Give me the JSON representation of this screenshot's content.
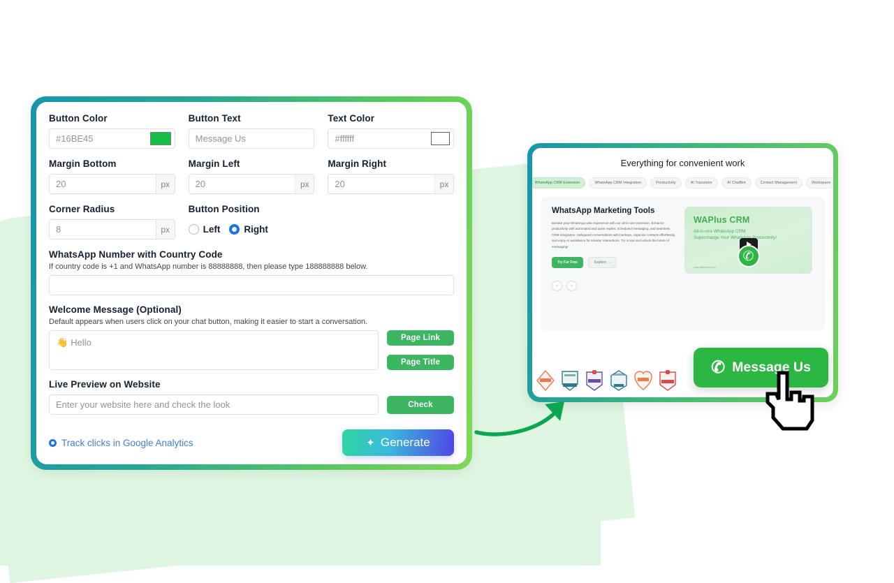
{
  "config": {
    "button_color": {
      "label": "Button Color",
      "value": "#16BE45",
      "swatch": "#16be45",
      "swatch_icon": "color-swatch-green"
    },
    "button_text": {
      "label": "Button Text",
      "placeholder": "Message Us"
    },
    "text_color": {
      "label": "Text Color",
      "value": "#ffffff",
      "swatch": "#ffffff",
      "swatch_icon": "color-swatch-white"
    },
    "margin_bottom": {
      "label": "Margin Bottom",
      "value": "20",
      "unit": "px"
    },
    "margin_left": {
      "label": "Margin Left",
      "value": "20",
      "unit": "px"
    },
    "margin_right": {
      "label": "Margin Right",
      "value": "20",
      "unit": "px"
    },
    "corner_radius": {
      "label": "Corner Radius",
      "value": "8",
      "unit": "px"
    },
    "button_position": {
      "label": "Button Position",
      "options": [
        "Left",
        "Right"
      ],
      "selected": "Right",
      "accent": "#1a73e8"
    },
    "whatsapp_number": {
      "label": "WhatsApp Number with Country Code",
      "hint": "If country code is +1 and WhatsApp number is 88888888, then please type 188888888 below.",
      "value": ""
    },
    "welcome_message": {
      "label": "Welcome Message (Optional)",
      "hint": "Default appears when users click on your chat button, making it easier to start a conversation.",
      "value": "Hello",
      "emoji": "👋",
      "page_link_label": "Page Link",
      "page_title_label": "Page Title"
    },
    "live_preview": {
      "label": "Live Preview on Website",
      "placeholder": "Enter your website here and check the look",
      "check_label": "Check"
    },
    "track_clicks": {
      "label": "Track clicks in Google Analytics",
      "selected": true,
      "color": "#3f7fd6"
    },
    "generate": {
      "label": "Generate",
      "icon": "sparkles-icon",
      "gradient_from": "#2fd6a0",
      "gradient_to": "#4f46e5"
    }
  },
  "preview": {
    "site_title": "Everything for convenient work",
    "tabs": [
      {
        "label": "WhatsApp CRM Extension",
        "active": true
      },
      {
        "label": "WhatsApp CRM Integration",
        "active": false
      },
      {
        "label": "Productivity",
        "active": false
      },
      {
        "label": "AI Translator",
        "active": false
      },
      {
        "label": "AI ChatBot",
        "active": false
      },
      {
        "label": "Contact Management",
        "active": false
      },
      {
        "label": "Workspace",
        "active": false
      }
    ],
    "hero": {
      "heading": "WhatsApp Marketing Tools",
      "paragraph": "Elevate your WhatsApp web experience with our all-in-one extension. Enhance productivity with automated and quick replies, scheduled messaging, and seamless CRM integration. Safeguard conversations with backups, organize contacts effortlessly, and enjoy AI assistance for smarter interactions. Try it now and unlock the future of messaging!",
      "primary_button": "Try For Free",
      "secondary_button": "Explore  →"
    },
    "promo": {
      "title": "WAPlus CRM",
      "subtitle_1": "All-in-one WhatsApp CRM",
      "subtitle_2": "Supercharge Your WhatsApp Productivity!",
      "footer": "www.wapluscrm.com",
      "play_icon": "youtube-play-icon",
      "logo_icon": "whatsapp-logo-icon"
    },
    "carousel": {
      "prev": "‹",
      "next": "›"
    },
    "badges": [
      {
        "name": "high-performer-badge",
        "color": "#f0784a"
      },
      {
        "name": "top-performer-badge",
        "color": "#2e7d8f"
      },
      {
        "name": "best-est-roi-badge",
        "color": "#6b4fa0"
      },
      {
        "name": "users-love-us-badge",
        "color": "#2e7d8f"
      },
      {
        "name": "customers-love-us-badge",
        "color": "#f0784a"
      },
      {
        "name": "high-performer-fall-badge",
        "color": "#d94c4c"
      }
    ]
  },
  "floating_button": {
    "label": "Message Us",
    "icon": "whatsapp-icon",
    "background": "#2bb741",
    "text_color": "#ffffff"
  },
  "decor": {
    "arrow_icon": "curved-arrow-icon",
    "arrow_color": "#0aa650",
    "cursor_icon": "pointing-hand-cursor"
  }
}
